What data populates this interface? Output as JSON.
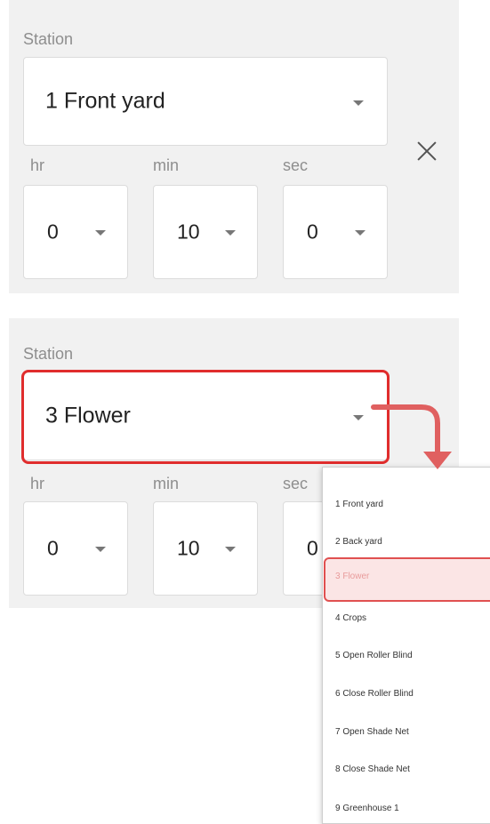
{
  "station_label": "Station",
  "remove_icon": "close-icon",
  "caret_icon": "chevron-down-icon",
  "entries": [
    {
      "station": "1 Front yard",
      "hr_label": "hr",
      "min_label": "min",
      "sec_label": "sec",
      "hr": "0",
      "min": "10",
      "sec": "0"
    },
    {
      "station": "3 Flower",
      "hr_label": "hr",
      "min_label": "min",
      "sec_label": "sec",
      "hr": "0",
      "min": "10",
      "sec": "0"
    }
  ],
  "dropdown": {
    "items": [
      "1 Front yard",
      "2 Back yard",
      "3 Flower",
      "4 Crops",
      "5 Open Roller Blind",
      "6 Close Roller Blind",
      "7 Open Shade Net",
      "8 Close Shade Net",
      "9 Greenhouse 1"
    ],
    "selected_index": 2
  },
  "colors": {
    "highlight": "#e02d2d",
    "arrow": "#e06060",
    "panel_bg": "#f1f1f1"
  }
}
